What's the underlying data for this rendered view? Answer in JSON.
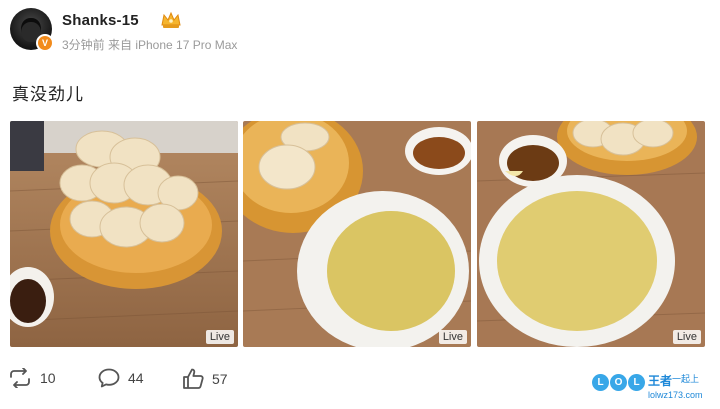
{
  "user": {
    "name": "Shanks-15",
    "verified_badge": "V",
    "meta": "3分钟前 来自 iPhone 17 Pro Max"
  },
  "post": {
    "text": "真没劲儿"
  },
  "photos": [
    {
      "live_label": "Live"
    },
    {
      "live_label": "Live"
    },
    {
      "live_label": "Live"
    }
  ],
  "actions": {
    "repost_count": "10",
    "comment_count": "44",
    "like_count": "57"
  },
  "watermark": {
    "letters": [
      "L",
      "O",
      "L"
    ],
    "brand": "王者",
    "brand_sub": "一起上",
    "url": "lolwz173.com"
  },
  "colors": {
    "accent": "#f28b1c",
    "watermark": "#1e88d8"
  }
}
